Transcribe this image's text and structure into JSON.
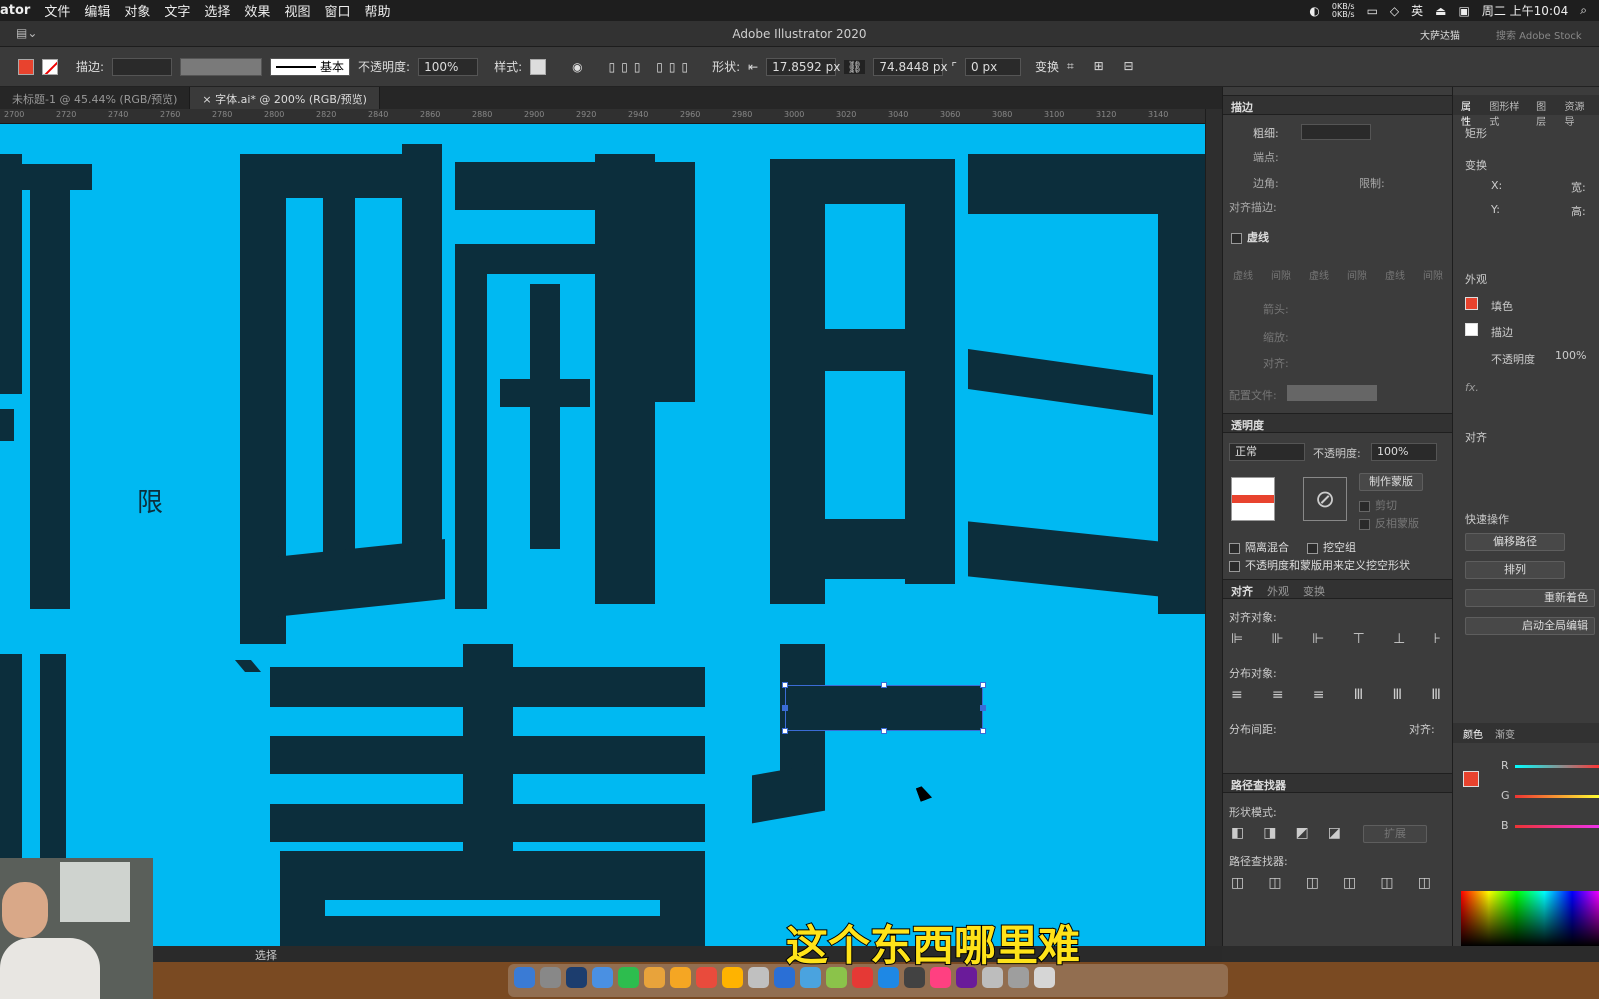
{
  "menubar": {
    "app": "ator",
    "items": [
      "文件",
      "编辑",
      "对象",
      "文字",
      "选择",
      "效果",
      "视图",
      "窗口",
      "帮助"
    ],
    "net": "0KB/s",
    "net2": "0KB/s",
    "ime": "英",
    "clock": "周二 上午10:04"
  },
  "titlebar": {
    "title": "Adobe Illustrator 2020",
    "workspace": "大萨达猫",
    "search_placeholder": "搜索 Adobe Stock"
  },
  "control": {
    "stroke_label": "描边:",
    "profile": "基本",
    "opacity_label": "不透明度:",
    "opacity": "100%",
    "style_label": "样式:",
    "shape_label": "形状:",
    "width": "17.8592 px",
    "height": "74.8448 px",
    "corner": "0 px",
    "transform": "变换",
    "fill_color": "#e8432e"
  },
  "tabs": [
    {
      "label": "未标题-1 @ 45.44% (RGB/预览)"
    },
    {
      "label": "字体.ai* @ 200% (RGB/预览)"
    }
  ],
  "ruler": [
    "2700",
    "2720",
    "2740",
    "2760",
    "2780",
    "2800",
    "2820",
    "2840",
    "2860",
    "2880",
    "2900",
    "2920",
    "2940",
    "2960",
    "2980",
    "3000",
    "3020",
    "3040",
    "3060",
    "3080",
    "3100",
    "3120",
    "3140"
  ],
  "canvas": {
    "glyph": "限",
    "bg": "#00b9f2",
    "ink": "#0c2e3c"
  },
  "status": {
    "tool": "选择"
  },
  "stroke_panel": {
    "title": "描边",
    "weight": "粗细:",
    "cap": "端点:",
    "corner": "边角:",
    "limit": "限制:",
    "align": "对齐描边:",
    "dashed": "虚线",
    "dash_labels": [
      "虚线",
      "间隙",
      "虚线",
      "间隙",
      "虚线",
      "间隙"
    ],
    "arrow": "箭头:",
    "scale": "缩放:",
    "align2": "对齐:",
    "profile": "配置文件:"
  },
  "transparency_panel": {
    "title": "透明度",
    "mode": "正常",
    "opacity_label": "不透明度:",
    "opacity": "100%",
    "make_mask": "制作蒙版",
    "clip": "剪切",
    "invert": "反相蒙版",
    "isolate": "隔离混合",
    "knockout": "挖空组",
    "define": "不透明度和蒙版用来定义挖空形状"
  },
  "align_panel": {
    "tabs": [
      "对齐",
      "外观",
      "变换"
    ],
    "align_objects": "对齐对象:",
    "distribute_objects": "分布对象:",
    "distribute_spacing": "分布间距:",
    "align_to": "对齐:"
  },
  "pathfinder_panel": {
    "title": "路径查找器",
    "shape_modes": "形状模式:",
    "expand": "扩展",
    "pathfinders": "路径查找器:"
  },
  "props_panel": {
    "tabs": [
      "属性",
      "图形样式",
      "图层",
      "资源导"
    ],
    "object": "矩形",
    "transform": "变换",
    "x": "X:",
    "y": "Y:",
    "w": "宽:",
    "h": "高:",
    "appearance": "外观",
    "fill": "填色",
    "stroke": "描边",
    "opacity": "不透明度",
    "opacity_val": "100%",
    "fx": "fx.",
    "align": "对齐",
    "quick": "快速操作",
    "offset_path": "偏移路径",
    "arrange": "排列",
    "recolor": "重新着色",
    "global_edit": "启动全局编辑"
  },
  "color_panel": {
    "tabs": [
      "颜色",
      "渐变"
    ],
    "r": "R",
    "g": "G",
    "b": "B"
  },
  "subtitle": "这个东西哪里难"
}
